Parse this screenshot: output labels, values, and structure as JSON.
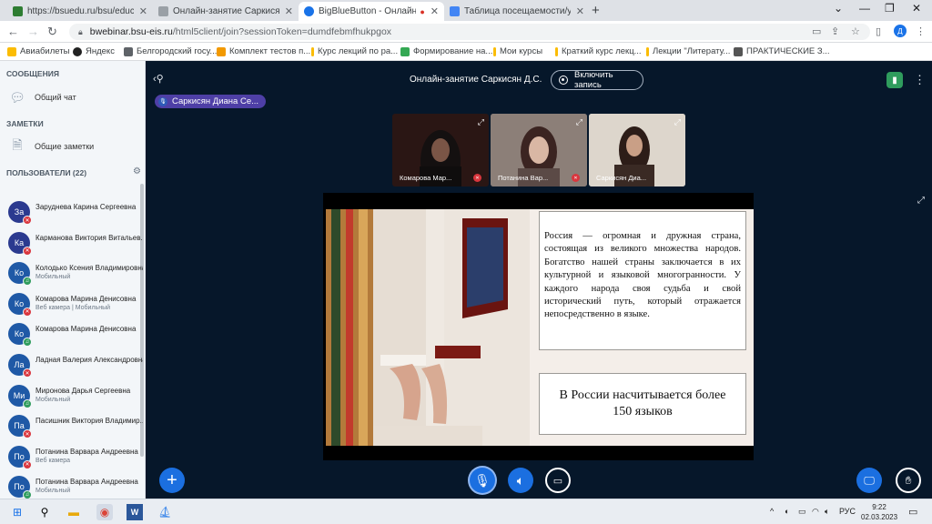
{
  "browser": {
    "tabs": [
      {
        "title": "https://bsuedu.ru/bsu/education",
        "active": false,
        "color": "#2e7d32"
      },
      {
        "title": "Онлайн-занятие Саркисян Д.С.",
        "active": false,
        "color": "#5f6368"
      },
      {
        "title": "BigBlueButton - Онлайн-зан",
        "active": true,
        "color": "#1a73e8"
      },
      {
        "title": "Таблица посещаемости/успева",
        "active": false,
        "color": "#4285f4"
      }
    ],
    "url_domain": "bwebinar.bsu-eis.ru",
    "url_path": "/html5client/join?sessionToken=dumdfebmfhukpgox",
    "profile_initial": "Д",
    "bookmarks": [
      "Авиабилеты",
      "Яндекс",
      "Белгородский госу...",
      "Комплект тестов п...",
      "Курс лекций по ра...",
      "Формирование на...",
      "Мои курсы",
      "Краткий курс лекц...",
      "Лекции \"Литерату...",
      "ПРАКТИЧЕСКИЕ З..."
    ]
  },
  "sidebar": {
    "messages_title": "СООБЩЕНИЯ",
    "public_chat": "Общий чат",
    "notes_title": "ЗАМЕТКИ",
    "shared_notes": "Общие заметки",
    "users_title": "ПОЛЬЗОВАТЕЛИ (22)",
    "users": [
      {
        "initials": "За",
        "name": "Заруднева Карина Сергеевна",
        "sub": "",
        "color": "#2b3a8f",
        "mic": "muted"
      },
      {
        "initials": "Ка",
        "name": "Карманова Виктория Витальев...",
        "sub": "",
        "color": "#2b3a8f",
        "mic": "muted"
      },
      {
        "initials": "Ко",
        "name": "Колодько Ксения Владимировна",
        "sub": "Мобильный",
        "color": "#1f59a6",
        "mic": "listen"
      },
      {
        "initials": "Ко",
        "name": "Комарова Марина Денисовна",
        "sub": "Веб камера | Мобильный",
        "color": "#1f59a6",
        "mic": "muted"
      },
      {
        "initials": "Ко",
        "name": "Комарова Марина Денисовна",
        "sub": "",
        "color": "#1f59a6",
        "mic": "listen"
      },
      {
        "initials": "Ла",
        "name": "Ладная Валерия Александровна",
        "sub": "",
        "color": "#1f59a6",
        "mic": "muted"
      },
      {
        "initials": "Ми",
        "name": "Миронова Дарья Сергеевна",
        "sub": "Мобильный",
        "color": "#1f59a6",
        "mic": "listen"
      },
      {
        "initials": "Па",
        "name": "Пасишник Виктория Владимир...",
        "sub": "",
        "color": "#1f59a6",
        "mic": "muted"
      },
      {
        "initials": "По",
        "name": "Потанина Варвара Андреевна",
        "sub": "Веб камера",
        "color": "#1f59a6",
        "mic": "muted"
      },
      {
        "initials": "По",
        "name": "Потанина Варвара Андреевна",
        "sub": "Мобильный",
        "color": "#1f59a6",
        "mic": "listen"
      }
    ]
  },
  "meeting": {
    "title": "Онлайн-занятие Саркисян Д.С.",
    "record_label": "Включить запись",
    "presenter": "Саркисян Диана Се...",
    "videos": [
      {
        "name": "Комарова Мар...",
        "bg": "#2a1614"
      },
      {
        "name": "Потанина Вар...",
        "bg": "#7a6a62"
      },
      {
        "name": "Саркисян Диа...",
        "bg": "#d7d0c6"
      }
    ]
  },
  "slide": {
    "paragraph": "Россия — огромная и дружная страна, состоящая из великого множества народов. Богатство нашей страны заключается в их культурной и языковой многогранности. У каждого народа своя судьба и свой исторический путь, который отражается непосредственно в языке.",
    "callout": "В России насчитывается более 150 языков"
  },
  "taskbar": {
    "lang": "РУС",
    "time": "9:22",
    "date": "02.03.2023"
  }
}
